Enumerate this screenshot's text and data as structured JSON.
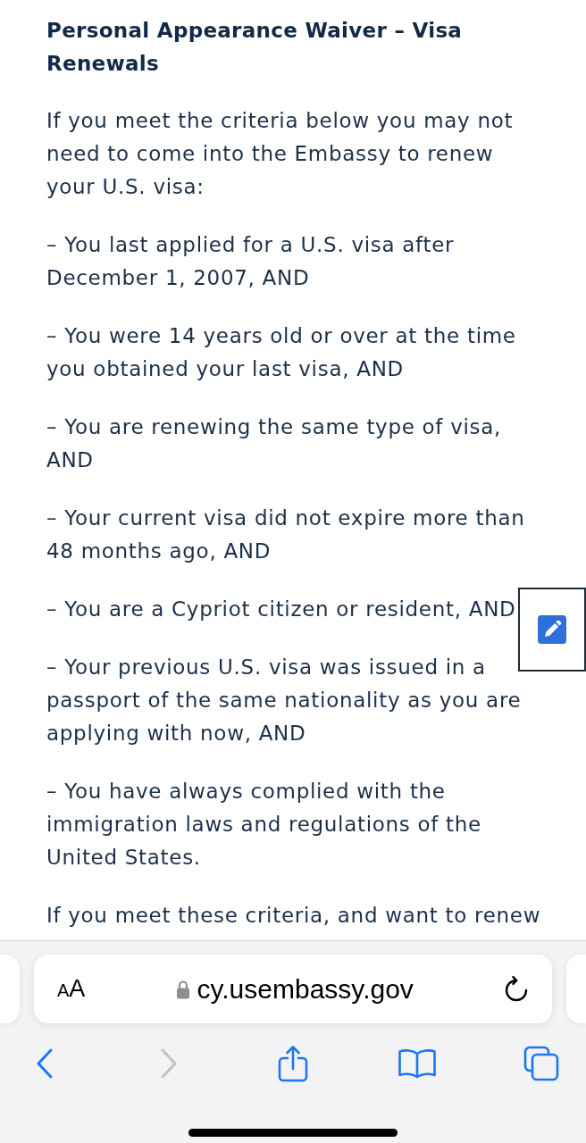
{
  "article": {
    "heading": "Personal Appearance Waiver – Visa Renewals",
    "intro": "If you meet the criteria below you may not need to come into the Embassy to renew your U.S. visa:",
    "criteria": [
      "– You last applied for a U.S. visa after December 1, 2007, AND",
      "– You were 14 years old or over at the time you obtained your last visa, AND",
      "– You are renewing the same type of visa, AND",
      "– Your current visa did not expire more than 48 months ago, AND",
      "– You are a Cypriot citizen or resident, AND",
      "– Your previous U.S. visa was issued in a passport of the same nationality as you are applying with now, AND",
      "– You have always complied with the immigration laws and regulations of the United States."
    ],
    "closing": "If you meet these criteria, and want to renew"
  },
  "browser": {
    "text_size_button": "AA",
    "secure": true,
    "url": "cy.usembassy.gov",
    "back": {
      "disabled": false
    },
    "forward": {
      "disabled": true
    }
  }
}
